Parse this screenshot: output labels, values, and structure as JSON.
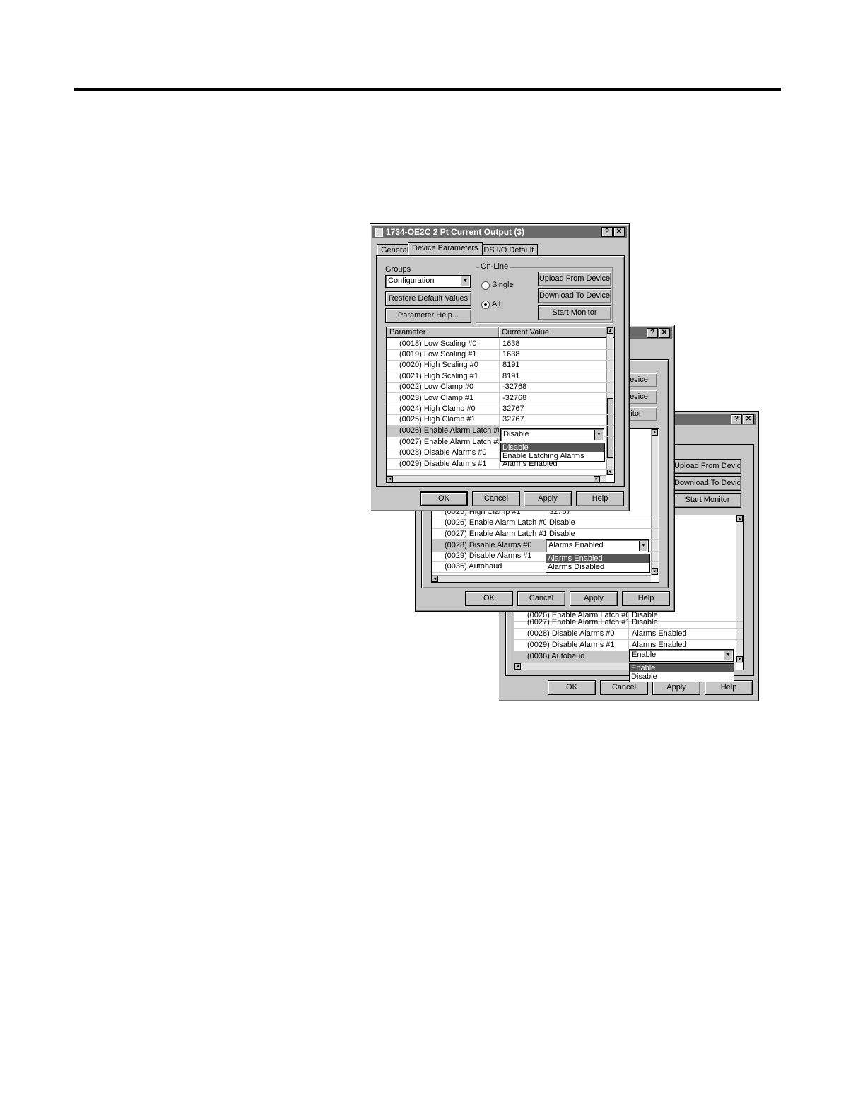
{
  "dialog_front": {
    "title": "1734-OE2C 2 Pt Current Output (3)",
    "tabs": [
      "General",
      "Device Parameters",
      "EDS I/O Default"
    ],
    "groups_label": "Groups",
    "groups_value": "Configuration",
    "restore_label": "Restore Default Values",
    "param_help_label": "Parameter Help...",
    "online_label": "On-Line",
    "single_label": "Single",
    "all_label": "All",
    "upload_label": "Upload From Device",
    "download_label": "Download To Device",
    "start_monitor_label": "Start Monitor",
    "col_parameter": "Parameter",
    "col_value": "Current Value",
    "rows": [
      {
        "p": "(0018) Low Scaling #0",
        "v": "1638"
      },
      {
        "p": "(0019) Low Scaling #1",
        "v": "1638"
      },
      {
        "p": "(0020) High Scaling #0",
        "v": "8191"
      },
      {
        "p": "(0021) High Scaling #1",
        "v": "8191"
      },
      {
        "p": "(0022) Low Clamp #0",
        "v": "-32768"
      },
      {
        "p": "(0023) Low Clamp #1",
        "v": "-32768"
      },
      {
        "p": "(0024) High Clamp #0",
        "v": "32767"
      },
      {
        "p": "(0025) High Clamp #1",
        "v": "32767"
      },
      {
        "p": "(0026) Enable Alarm Latch #0",
        "v": "Disable"
      },
      {
        "p": "(0027) Enable Alarm Latch #1",
        "v": ""
      },
      {
        "p": "(0028) Disable Alarms #0",
        "v": ""
      },
      {
        "p": "(0029) Disable Alarms #1",
        "v": "Alarms Enabled"
      }
    ],
    "dropdown_options": [
      "Disable",
      "Enable Latching Alarms"
    ],
    "ok": "OK",
    "cancel": "Cancel",
    "apply": "Apply",
    "help": "Help"
  },
  "dialog_middle": {
    "device1": "Device",
    "device2": "Device",
    "monitor": "itor",
    "rows": [
      {
        "p": "(0025) High Clamp #1",
        "v": "32767"
      },
      {
        "p": "(0026) Enable Alarm Latch #0",
        "v": "Disable"
      },
      {
        "p": "(0027) Enable Alarm Latch #1",
        "v": "Disable"
      },
      {
        "p": "(0028) Disable Alarms #0",
        "v": "Alarms Enabled"
      },
      {
        "p": "(0029) Disable Alarms #1",
        "v": ""
      },
      {
        "p": "(0036) Autobaud",
        "v": ""
      }
    ],
    "dropdown_options": [
      "Alarms Enabled",
      "Alarms Disabled"
    ],
    "ok": "OK",
    "cancel": "Cancel",
    "apply": "Apply",
    "help": "Help"
  },
  "dialog_back": {
    "upload_label": "Upload From Device",
    "download_label": "Download To Device",
    "start_monitor_label": "Start Monitor",
    "rows": [
      {
        "p": "(0026) Enable Alarm Latch #0",
        "v": "Disable"
      },
      {
        "p": "(0027) Enable Alarm Latch #1",
        "v": "Disable"
      },
      {
        "p": "(0028) Disable Alarms #0",
        "v": "Alarms Enabled"
      },
      {
        "p": "(0029) Disable Alarms #1",
        "v": "Alarms Enabled"
      },
      {
        "p": "(0036) Autobaud",
        "v": "Enable"
      }
    ],
    "dropdown_options": [
      "Enable",
      "Disable"
    ],
    "ok": "OK",
    "cancel": "Cancel",
    "apply": "Apply",
    "help": "Help"
  }
}
